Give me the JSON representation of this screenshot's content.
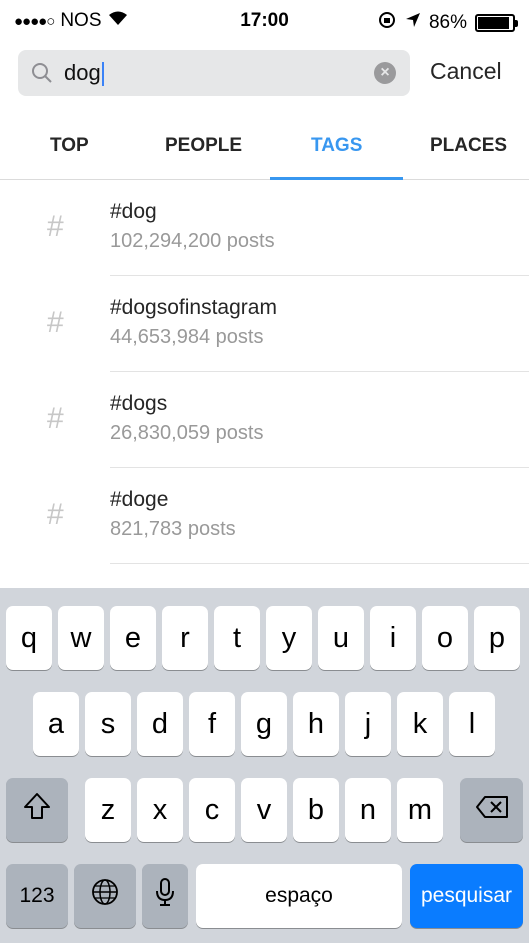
{
  "status_bar": {
    "signal": "●●●●○",
    "carrier": "NOS",
    "wifi_icon": "wifi-icon",
    "time": "17:00",
    "rotation_lock_icon": "rotation-lock-icon",
    "location_icon": "location-arrow-icon",
    "battery": "86%",
    "battery_level": 0.86
  },
  "search": {
    "query": "dog",
    "cancel_label": "Cancel"
  },
  "tabs": [
    {
      "label": "TOP"
    },
    {
      "label": "PEOPLE"
    },
    {
      "label": "TAGS",
      "active": true
    },
    {
      "label": "PLACES"
    }
  ],
  "results": [
    {
      "icon": "#",
      "name": "#dog",
      "count": "102,294,200 posts"
    },
    {
      "icon": "#",
      "name": "#dogsofinstagram",
      "count": "44,653,984 posts"
    },
    {
      "icon": "#",
      "name": "#dogs",
      "count": "26,830,059 posts"
    },
    {
      "icon": "#",
      "name": "#doge",
      "count": "821,783 posts"
    }
  ],
  "keyboard": {
    "row1": [
      "q",
      "w",
      "e",
      "r",
      "t",
      "y",
      "u",
      "i",
      "o",
      "p"
    ],
    "row2": [
      "a",
      "s",
      "d",
      "f",
      "g",
      "h",
      "j",
      "k",
      "l"
    ],
    "row3": [
      "z",
      "x",
      "c",
      "v",
      "b",
      "n",
      "m"
    ],
    "numbers_label": "123",
    "space_label": "espaço",
    "search_label": "pesquisar",
    "shift_icon": "shift-icon",
    "globe_icon": "globe-icon",
    "mic_icon": "microphone-icon",
    "backspace_icon": "backspace-icon"
  },
  "colors": {
    "accent": "#3897f0",
    "search_key": "#0a7cff"
  }
}
